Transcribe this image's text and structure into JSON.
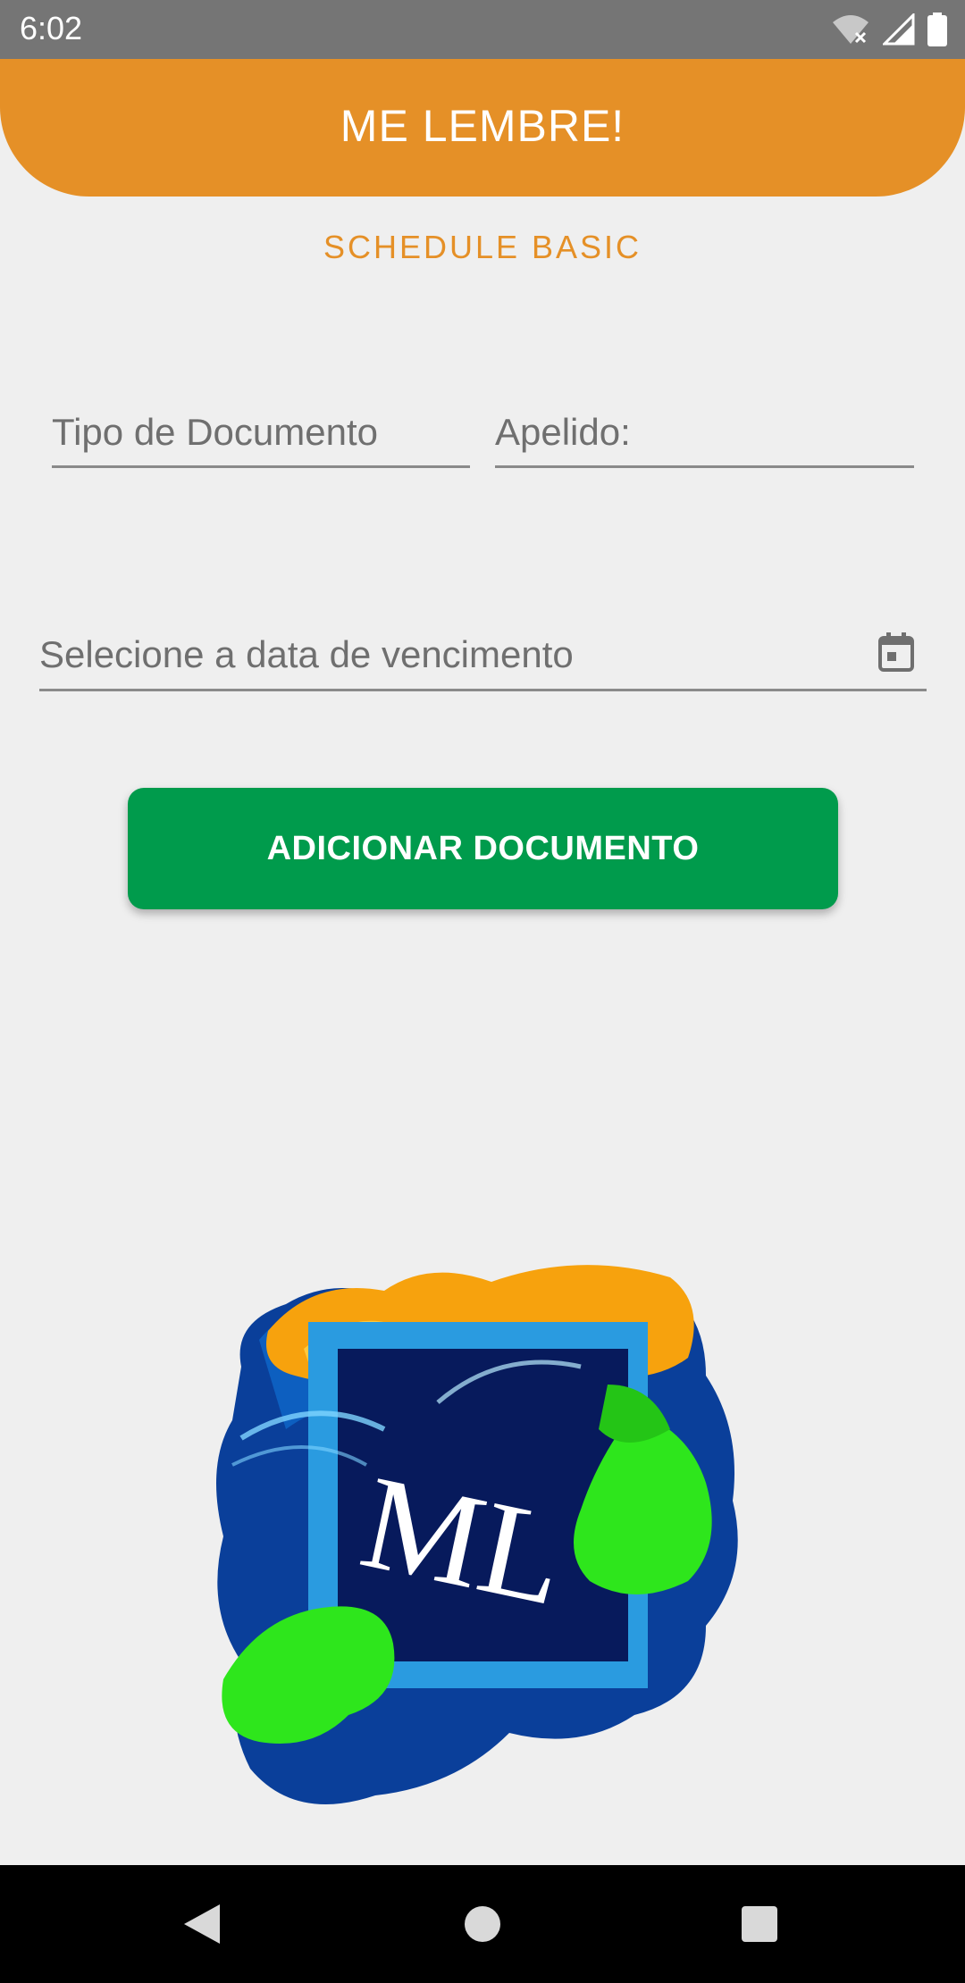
{
  "status_bar": {
    "time": "6:02",
    "icons": [
      "wifi-off-icon",
      "signal-icon",
      "battery-icon"
    ]
  },
  "app_bar": {
    "title": "ME LEMBRE!"
  },
  "subtitle": "SCHEDULE BASIC",
  "form": {
    "tipo_documento": {
      "placeholder": "Tipo de Documento",
      "value": ""
    },
    "apelido": {
      "placeholder": "Apelido:",
      "value": ""
    },
    "data_vencimento": {
      "placeholder": "Selecione a data de vencimento",
      "value": ""
    }
  },
  "add_button": {
    "label": "ADICIONAR DOCUMENTO"
  },
  "logo": {
    "text": "ML"
  },
  "nav_bar": {
    "buttons": [
      "back-icon",
      "home-icon",
      "recents-icon"
    ]
  },
  "colors": {
    "accent_orange": "#e59027",
    "button_green": "#009b4c",
    "status_bar": "#757575",
    "background": "#efefef"
  }
}
